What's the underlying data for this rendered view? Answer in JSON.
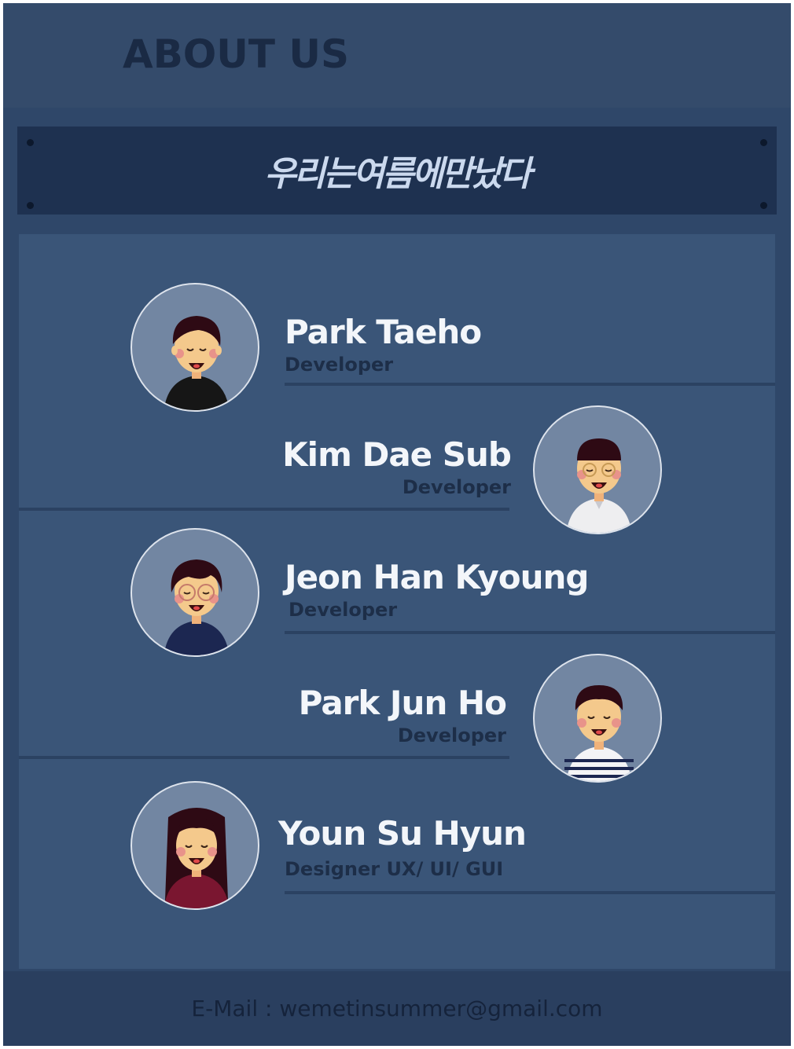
{
  "header": {
    "title": "ABOUT US"
  },
  "banner": {
    "title": "우리는여름에만났다"
  },
  "members": [
    {
      "name": "Park Taeho",
      "role": "Developer",
      "avatar_icon": "boy-avatar-black-shirt-icon"
    },
    {
      "name": "Kim Dae Sub",
      "role": "Developer",
      "avatar_icon": "boy-avatar-white-shirt-glasses-icon"
    },
    {
      "name": "Jeon Han Kyoung",
      "role": "Developer",
      "avatar_icon": "avatar-navy-shirt-round-glasses-icon"
    },
    {
      "name": "Park Jun Ho",
      "role": "Developer",
      "avatar_icon": "boy-avatar-striped-shirt-icon"
    },
    {
      "name": "Youn Su Hyun",
      "role": "Designer  UX/ UI/ GUI",
      "avatar_icon": "girl-avatar-long-hair-icon"
    }
  ],
  "footer": {
    "email": "E-Mail : wemetinsummer@gmail.com"
  },
  "colors": {
    "background": "#2f4769",
    "panel": "#3a5578",
    "banner": "#1e3150",
    "name_text": "#f3f6fa",
    "role_text": "#1d2e48"
  }
}
